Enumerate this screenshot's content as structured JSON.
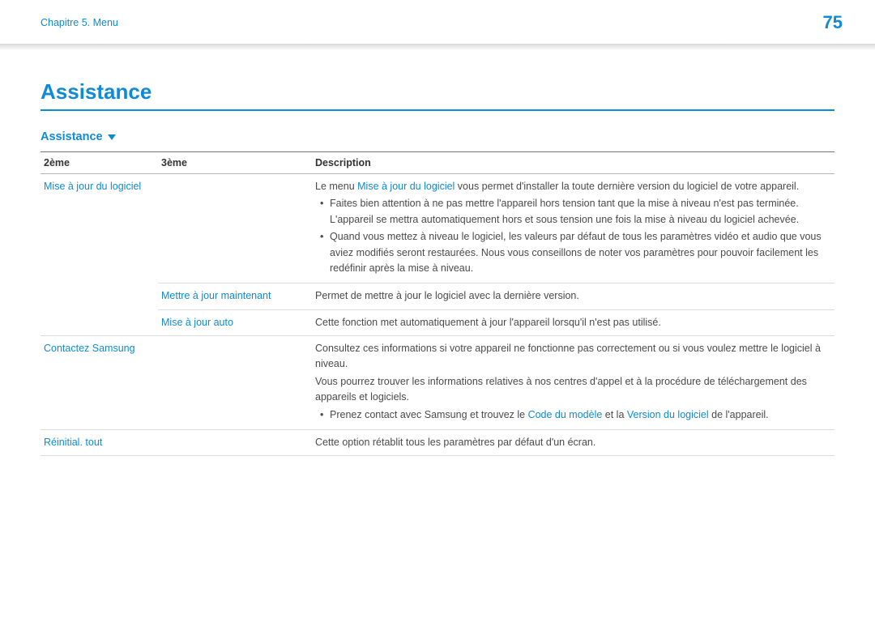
{
  "header": {
    "chapter_label": "Chapitre 5. Menu",
    "page_number": "75"
  },
  "page_title": "Assistance",
  "section_title": "Assistance",
  "columns": {
    "col1": "2ème",
    "col2": "3ème",
    "col3": "Description"
  },
  "rows": {
    "software_update": {
      "col1_label": "Mise à jour du logiciel",
      "desc_prefix": "Le menu ",
      "desc_link": "Mise à jour du logiciel",
      "desc_suffix": " vous permet d'installer la toute dernière version du logiciel de votre appareil.",
      "bullet1": "Faites bien attention à ne pas mettre l'appareil hors tension tant que la mise à niveau n'est pas terminée. L'appareil se mettra automatiquement hors et sous tension une fois la mise à niveau du logiciel achevée.",
      "bullet2": "Quand vous mettez à niveau le logiciel, les valeurs par défaut de tous les paramètres vidéo et audio que vous aviez modifiés seront restaurées. Nous vous conseillons de noter vos paramètres pour pouvoir facilement les redéfinir après la mise à niveau."
    },
    "update_now": {
      "col2_label": "Mettre à jour maintenant",
      "desc": "Permet de mettre à jour le logiciel avec la dernière version."
    },
    "auto_update": {
      "col2_label": "Mise à jour auto",
      "desc": "Cette fonction met automatiquement à jour l'appareil lorsqu'il n'est pas utilisé."
    },
    "contact": {
      "col1_label": "Contactez Samsung",
      "desc_p1": "Consultez ces informations si votre appareil ne fonctionne pas correctement ou si vous voulez mettre le logiciel à niveau.",
      "desc_p2": "Vous pourrez trouver les informations relatives à nos centres d'appel et à la procédure de téléchargement des appareils et logiciels.",
      "bullet_prefix": "Prenez contact avec Samsung et trouvez le ",
      "bullet_link1": "Code du modèle",
      "bullet_mid": " et la ",
      "bullet_link2": "Version du logiciel",
      "bullet_suffix": " de l'appareil."
    },
    "reset": {
      "col1_label": "Réinitial. tout",
      "desc": "Cette option rétablit tous les paramètres par défaut d'un écran."
    }
  }
}
